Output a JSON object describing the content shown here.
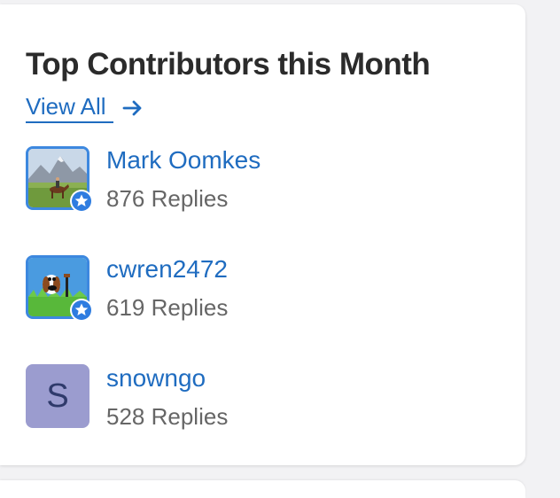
{
  "widget": {
    "title": "Top Contributors this Month",
    "view_all_label": "View All"
  },
  "contributors": [
    {
      "name": "Mark Oomkes",
      "replies": "876 Replies",
      "avatar": "horse-rider-photo",
      "badge": "star-badge-icon"
    },
    {
      "name": "cwren2472",
      "replies": "619 Replies",
      "avatar": "cartoon-dog-photo",
      "badge": "star-badge-icon"
    },
    {
      "name": "snowngo",
      "replies": "528 Replies",
      "avatar_letter": "S",
      "avatar_color": "#9b9ccf"
    }
  ],
  "colors": {
    "link": "#1f6cc0",
    "avatar_border": "#3d88df",
    "title": "#2b2b2b",
    "muted": "#666666"
  }
}
